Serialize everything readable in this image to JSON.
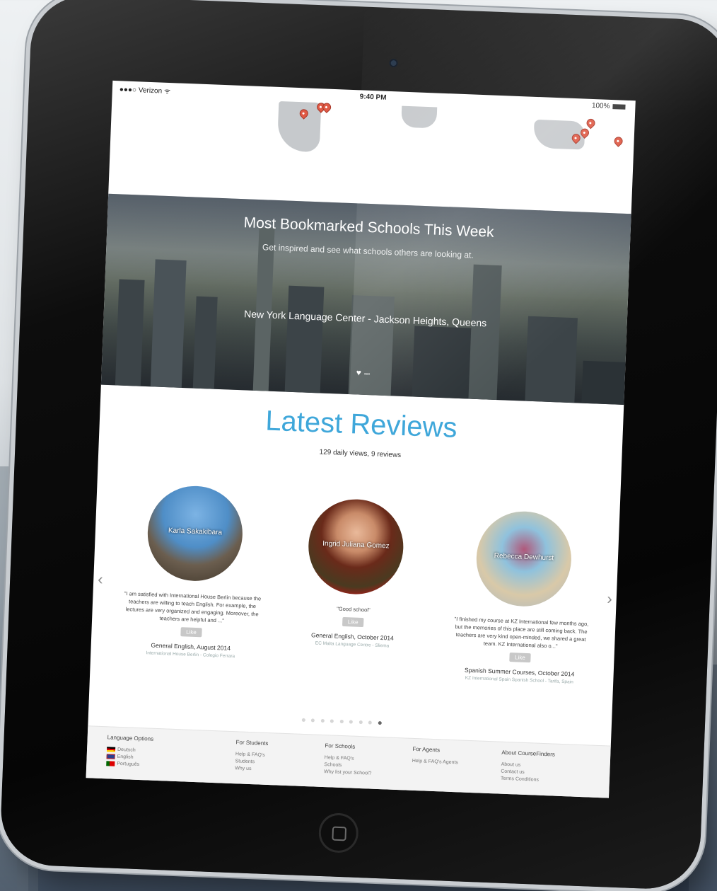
{
  "status_bar": {
    "carrier": "Verizon",
    "time": "9:40 PM",
    "battery": "100%"
  },
  "hero": {
    "title": "Most Bookmarked Schools This Week",
    "subtitle": "Get inspired and see what schools others are looking at.",
    "school": "New York Language Center - Jackson Heights, Queens"
  },
  "reviews": {
    "title": "Latest Reviews",
    "subtitle": "129 daily views, 9 reviews",
    "cards": [
      {
        "name": "Karla Sakakibara",
        "quote": "\"I am satisfied with International House Berlin because the teachers are willing to teach English. For example, the lectures are very organized and engaging. Moreover, the teachers are helpful and ...\"",
        "like": "Like",
        "author": "General English, August 2014",
        "school": "International House Berlin - Colegio Ferrara"
      },
      {
        "name": "Ingrid Juliana Gomez",
        "quote": "\"Good school\"",
        "like": "Like",
        "author": "General English, October 2014",
        "school": "EC Malta Language Centre - Sliema"
      },
      {
        "name": "Rebecca Dewhurst",
        "quote": "\"I finished my course at KZ International few months ago, but the memories of this place are still coming back. The teachers are very kind open-minded, we shared a great team. KZ International also o...\"",
        "like": "Like",
        "author": "Spanish Summer Courses, October 2014",
        "school": "KZ International Spain Spanish School - Tarifa, Spain"
      }
    ]
  },
  "footer": {
    "columns": [
      {
        "heading": "Language Options",
        "items": [
          "Deutsch",
          "English",
          "Português"
        ]
      },
      {
        "heading": "For Students",
        "items": [
          "Help & FAQ's",
          "Students",
          "Why us"
        ]
      },
      {
        "heading": "For Schools",
        "items": [
          "Help & FAQ's",
          "Schools",
          "Why list your School?"
        ]
      },
      {
        "heading": "For Agents",
        "items": [
          "Help & FAQ's Agents"
        ]
      },
      {
        "heading": "About CourseFinders",
        "items": [
          "About us",
          "Contact us",
          "Terms Conditions"
        ]
      }
    ]
  },
  "colors": {
    "accent": "#3fa7da",
    "pin": "#e05a45"
  }
}
